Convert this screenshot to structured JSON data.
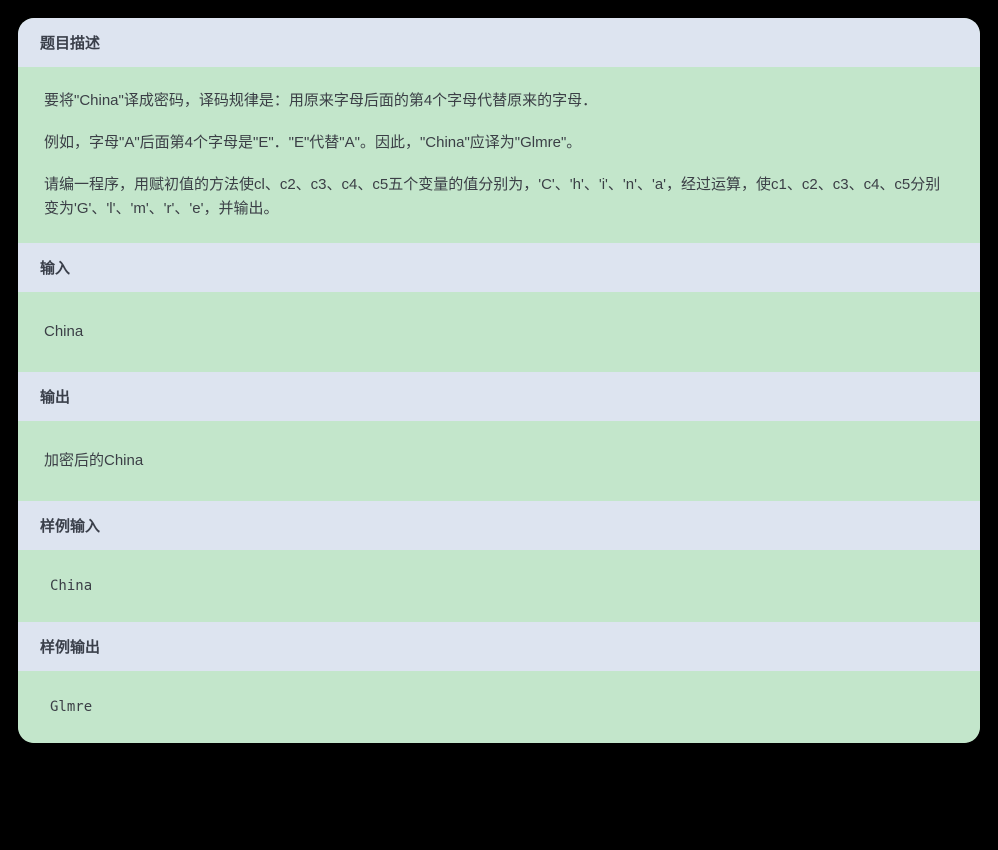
{
  "sections": {
    "description": {
      "header": "题目描述",
      "p1": "要将\"China\"译成密码，译码规律是：用原来字母后面的第4个字母代替原来的字母．",
      "p2": "例如，字母\"A\"后面第4个字母是\"E\"．\"E\"代替\"A\"。因此，\"China\"应译为\"Glmre\"。",
      "p3": "请编一程序，用赋初值的方法使cl、c2、c3、c4、c5五个变量的值分别为，'C'、'h'、'i'、'n'、'a'，经过运算，使c1、c2、c3、c4、c5分别变为'G'、'l'、'm'、'r'、'e'，并输出。"
    },
    "input": {
      "header": "输入",
      "content": "China"
    },
    "output": {
      "header": "输出",
      "content": "加密后的China"
    },
    "sample_input": {
      "header": "样例输入",
      "content": "China"
    },
    "sample_output": {
      "header": "样例输出",
      "content": "Glmre"
    }
  }
}
